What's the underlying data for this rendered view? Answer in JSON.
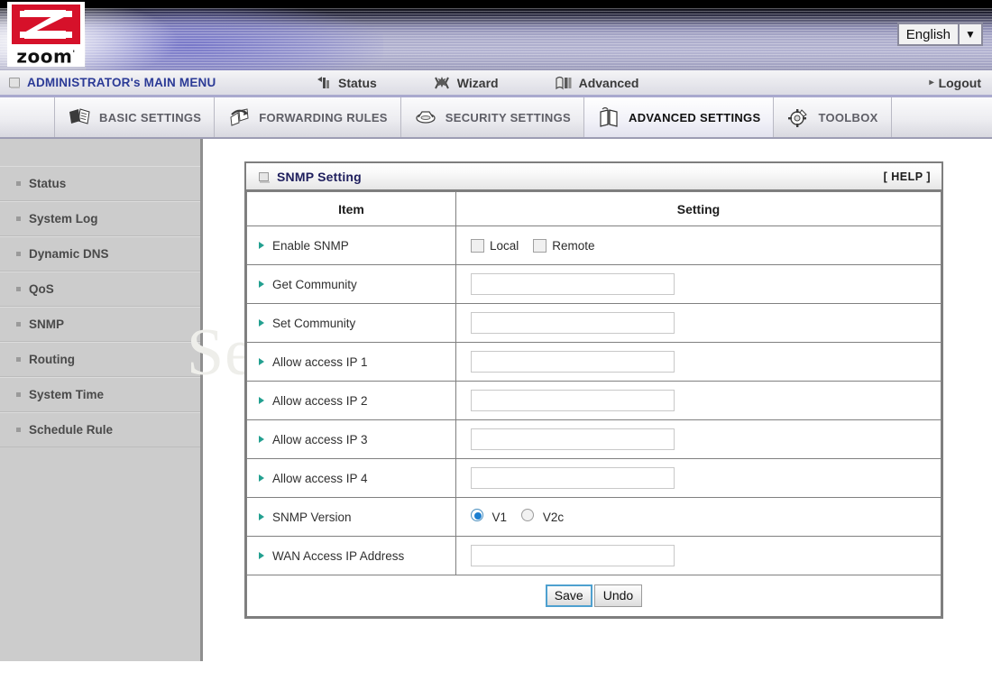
{
  "header": {
    "logo_word": "zoom",
    "logo_tm": "'",
    "language_value": "English",
    "dropdown_arrow": "chevron-down-icon"
  },
  "nav": {
    "admin_label": "ADMINISTRATOR's MAIN MENU",
    "items": [
      {
        "label": "Status",
        "icon": "status-icon"
      },
      {
        "label": "Wizard",
        "icon": "wizard-icon"
      },
      {
        "label": "Advanced",
        "icon": "advanced-icon"
      }
    ],
    "logout_label": "Logout",
    "logout_caret": "▸"
  },
  "tabs": [
    {
      "label": "BASIC SETTINGS",
      "icon": "folder-pages-icon",
      "active": false
    },
    {
      "label": "FORWARDING RULES",
      "icon": "arrow-pages-icon",
      "active": false
    },
    {
      "label": "SECURITY SETTINGS",
      "icon": "shield-icon",
      "active": false
    },
    {
      "label": "ADVANCED SETTINGS",
      "icon": "book-icon",
      "active": true
    },
    {
      "label": "TOOLBOX",
      "icon": "gear-icon",
      "active": false
    }
  ],
  "sidebar": {
    "items": [
      {
        "label": "Status"
      },
      {
        "label": "System Log"
      },
      {
        "label": "Dynamic DNS"
      },
      {
        "label": "QoS"
      },
      {
        "label": "SNMP"
      },
      {
        "label": "Routing"
      },
      {
        "label": "System Time"
      },
      {
        "label": "Schedule Rule"
      }
    ]
  },
  "watermark": {
    "text": "SetupRouter.com"
  },
  "panel": {
    "title": "SNMP Setting",
    "help_label": "[ HELP ]",
    "columns": {
      "item": "Item",
      "setting": "Setting"
    },
    "rows": [
      {
        "label": "Enable SNMP",
        "type": "checkboxes",
        "checkboxes": [
          {
            "label": "Local",
            "checked": false
          },
          {
            "label": "Remote",
            "checked": false
          }
        ]
      },
      {
        "label": "Get Community",
        "type": "text",
        "value": ""
      },
      {
        "label": "Set Community",
        "type": "text",
        "value": ""
      },
      {
        "label": "Allow access IP 1",
        "type": "text",
        "value": ""
      },
      {
        "label": "Allow access IP 2",
        "type": "text",
        "value": ""
      },
      {
        "label": "Allow access IP 3",
        "type": "text",
        "value": ""
      },
      {
        "label": "Allow access IP 4",
        "type": "text",
        "value": ""
      },
      {
        "label": "SNMP Version",
        "type": "radios",
        "radios": [
          {
            "label": "V1",
            "selected": true
          },
          {
            "label": "V2c",
            "selected": false
          }
        ]
      },
      {
        "label": "WAN Access IP Address",
        "type": "text",
        "value": ""
      }
    ],
    "buttons": {
      "save": "Save",
      "undo": "Undo"
    }
  },
  "colors": {
    "accent_blue": "#2b3a96",
    "panel_title": "#20205e",
    "arrow_teal": "#23a090",
    "radio_on": "#1d7fd0",
    "sidebar_bg": "#cccccc",
    "logo_red": "#d6112a"
  }
}
